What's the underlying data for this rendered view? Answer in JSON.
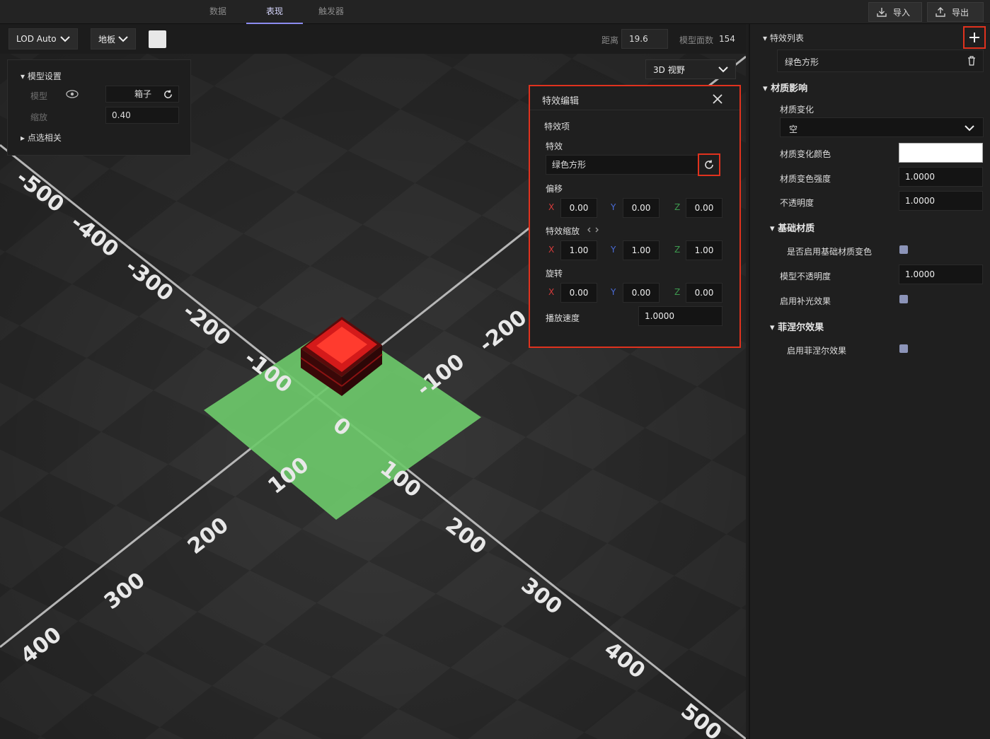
{
  "tabs": [
    {
      "label": "数据"
    },
    {
      "label": "表现"
    },
    {
      "label": "触发器"
    }
  ],
  "header": {
    "import_label": "导入",
    "export_label": "导出"
  },
  "toolbar": {
    "lod_label": "LOD Auto",
    "floor_label": "地板",
    "distance_label": "距离",
    "distance_value": "19.6",
    "faces_label": "模型面数",
    "faces_value": "154",
    "view_label": "3D 视野"
  },
  "model_panel": {
    "title": "模型设置",
    "model_label": "模型",
    "model_value": "箱子",
    "scale_label": "缩放",
    "scale_value": "0.40",
    "pick_label": "点选相关"
  },
  "fx_editor": {
    "title": "特效编辑",
    "item_label": "特效项",
    "fx_label": "特效",
    "fx_value": "绿色方形",
    "offset_label": "偏移",
    "offset": {
      "x": "0.00",
      "y": "0.00",
      "z": "0.00"
    },
    "scale_label": "特效缩放",
    "scale": {
      "x": "1.00",
      "y": "1.00",
      "z": "1.00"
    },
    "rotate_label": "旋转",
    "rotate": {
      "x": "0.00",
      "y": "0.00",
      "z": "0.00"
    },
    "speed_label": "播放速度",
    "speed_value": "1.0000",
    "axis_x": "X",
    "axis_y": "Y",
    "axis_z": "Z"
  },
  "sidebar": {
    "fx_list_title": "特效列表",
    "fx_list_item": "绿色方形",
    "material_section": "材质影响",
    "material_change_label": "材质变化",
    "material_change_value": "空",
    "material_color_label": "材质变化颜色",
    "material_strength_label": "材质变色强度",
    "material_strength_value": "1.0000",
    "opacity_label": "不透明度",
    "opacity_value": "1.0000",
    "base_section": "基础材质",
    "base_enable_label": "是否启用基础材质变色",
    "model_opacity_label": "模型不透明度",
    "model_opacity_value": "1.0000",
    "fill_light_label": "启用补光效果",
    "fresnel_section": "菲涅尔效果",
    "fresnel_enable_label": "启用菲涅尔效果"
  },
  "grid_labels": {
    "left_axis": [
      "-500",
      "-400",
      "-300",
      "-200",
      "-100"
    ],
    "right_axis": [
      "-200",
      "-100"
    ],
    "origin": "0",
    "front_left": [
      "100",
      "200",
      "300",
      "400"
    ],
    "front_right": [
      "100",
      "200",
      "300",
      "400",
      "500"
    ]
  }
}
